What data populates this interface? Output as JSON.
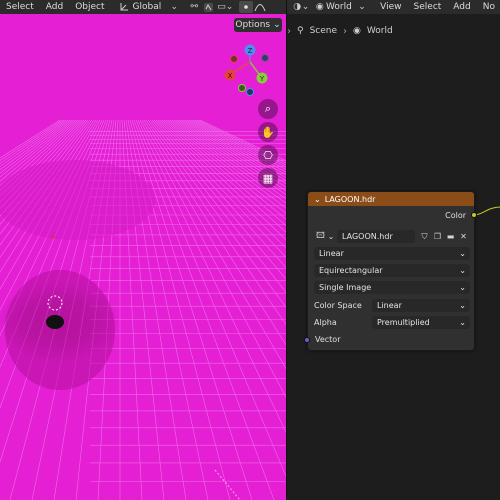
{
  "viewport": {
    "menu": [
      "Select",
      "Add",
      "Object"
    ],
    "orientation": "Global",
    "options_label": "Options",
    "gizmo_labels": {
      "y": "Y",
      "x": "X",
      "z": "Z"
    },
    "bg_color": "#e41fd4",
    "grid_color": "#f06bea"
  },
  "node_editor": {
    "header": {
      "world_label": "World",
      "menu": [
        "View",
        "Select",
        "Add",
        "No"
      ]
    },
    "breadcrumb": [
      "Scene",
      "World"
    ],
    "node": {
      "title": "LAGOON.hdr",
      "output_label": "Color",
      "image_name": "LAGOON.hdr",
      "interpolation": "Linear",
      "projection": "Equirectangular",
      "source": "Single Image",
      "color_space_label": "Color Space",
      "color_space_value": "Linear",
      "alpha_label": "Alpha",
      "alpha_value": "Premultiplied",
      "input_label": "Vector",
      "header_color": "#8a4d18",
      "color_socket": "#c7c729",
      "vector_socket": "#6363c7"
    }
  }
}
